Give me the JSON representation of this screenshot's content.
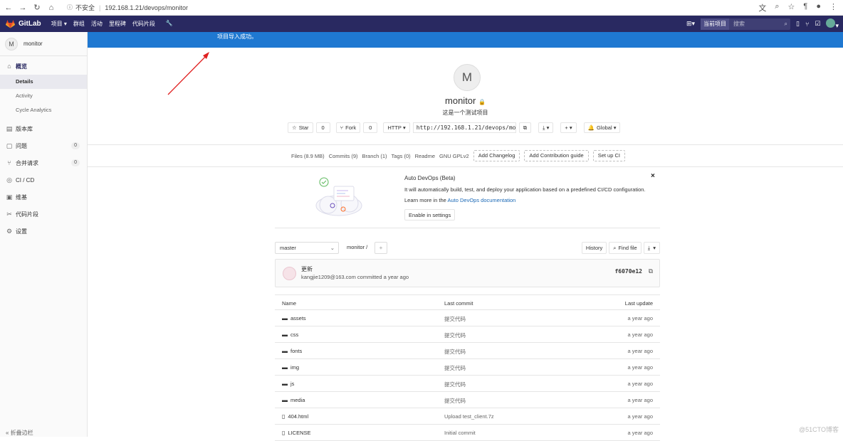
{
  "browser": {
    "security_label": "不安全",
    "url": "192.168.1.21/devops/monitor"
  },
  "header": {
    "brand": "GitLab",
    "nav": [
      "项目 ▾",
      "群组",
      "活动",
      "里程碑",
      "代码片段"
    ],
    "search_scope": "当前项目",
    "search_placeholder": "搜索"
  },
  "sidebar": {
    "project_initial": "M",
    "project_name": "monitor",
    "overview": "概览",
    "overview_sub": [
      "Details",
      "Activity",
      "Cycle Analytics"
    ],
    "items": [
      {
        "label": "版本库",
        "badge": ""
      },
      {
        "label": "问题",
        "badge": "0"
      },
      {
        "label": "合并请求",
        "badge": "0"
      },
      {
        "label": "CI / CD",
        "badge": ""
      },
      {
        "label": "维基",
        "badge": ""
      },
      {
        "label": "代码片段",
        "badge": ""
      },
      {
        "label": "设置",
        "badge": ""
      }
    ],
    "collapse": "折叠边栏"
  },
  "flash": {
    "message": "项目导入成功。"
  },
  "project": {
    "initial": "M",
    "name": "monitor",
    "description": "这是一个测试项目",
    "star_label": "Star",
    "star_count": "0",
    "fork_label": "Fork",
    "fork_count": "0",
    "protocol": "HTTP",
    "clone_url": "http://192.168.1.21/devops/monitor.git",
    "notification": "Global"
  },
  "stats": {
    "files": "Files (8.9 MB)",
    "commits": "Commits (9)",
    "branch": "Branch (1)",
    "tags": "Tags (0)",
    "readme": "Readme",
    "license": "GNU GPLv2",
    "add_changelog": "Add Changelog",
    "add_contrib": "Add Contribution guide",
    "setup_ci": "Set up CI"
  },
  "devops": {
    "title": "Auto DevOps (Beta)",
    "desc": "It will automatically build, test, and deploy your application based on a predefined CI/CD configuration.",
    "learn_prefix": "Learn more in the ",
    "learn_link": "Auto DevOps documentation",
    "enable": "Enable in settings"
  },
  "tree": {
    "branch": "master",
    "crumb": "monitor /",
    "history": "History",
    "find_file": "Find file"
  },
  "commit": {
    "title": "更新",
    "meta": "kangjie1209@163.com committed a year ago",
    "sha": "f6070e12"
  },
  "table": {
    "headers": [
      "Name",
      "Last commit",
      "Last update"
    ],
    "rows": [
      {
        "name": "assets",
        "type": "folder",
        "commit": "提交代码",
        "update": "a year ago"
      },
      {
        "name": "css",
        "type": "folder",
        "commit": "提交代码",
        "update": "a year ago"
      },
      {
        "name": "fonts",
        "type": "folder",
        "commit": "提交代码",
        "update": "a year ago"
      },
      {
        "name": "img",
        "type": "folder",
        "commit": "提交代码",
        "update": "a year ago"
      },
      {
        "name": "js",
        "type": "folder",
        "commit": "提交代码",
        "update": "a year ago"
      },
      {
        "name": "media",
        "type": "folder",
        "commit": "提交代码",
        "update": "a year ago"
      },
      {
        "name": "404.html",
        "type": "file",
        "commit": "Upload test_client.7z",
        "update": "a year ago"
      },
      {
        "name": "LICENSE",
        "type": "file",
        "commit": "Initial commit",
        "update": "a year ago"
      }
    ]
  },
  "watermark": "@51CTO博客"
}
